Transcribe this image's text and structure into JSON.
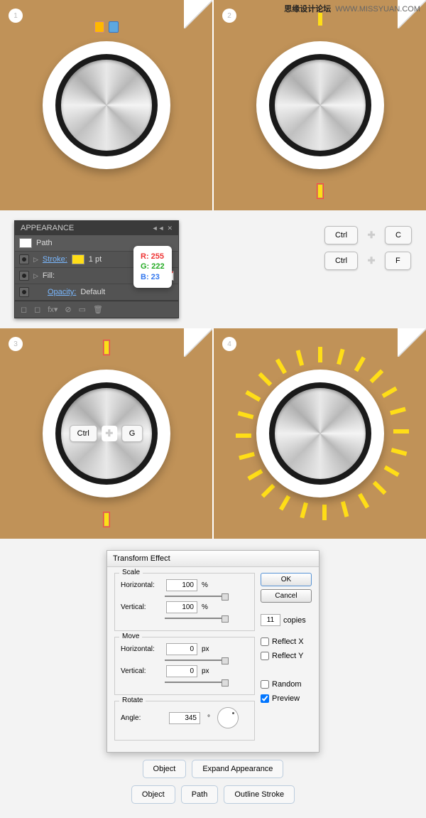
{
  "watermark": {
    "site": "思缘设计论坛",
    "url": "WWW.MISSYUAN.COM"
  },
  "steps": {
    "s1": "1",
    "s2": "2",
    "s3": "3",
    "s4": "4"
  },
  "appearance": {
    "title": "APPEARANCE",
    "path": "Path",
    "stroke_label": "Stroke:",
    "stroke_pt": "1 pt",
    "fill_label": "Fill:",
    "opacity_label": "Opacity:",
    "opacity_val": "Default"
  },
  "rgb": {
    "r": "R: 255",
    "g": "G: 222",
    "b": "B: 23"
  },
  "shortcut": {
    "ctrl": "Ctrl",
    "c": "C",
    "f": "F",
    "g": "G"
  },
  "dialog": {
    "title": "Transform Effect",
    "scale": "Scale",
    "move": "Move",
    "rotate": "Rotate",
    "horizontal": "Horizontal:",
    "vertical": "Vertical:",
    "angle": "Angle:",
    "scale_h": "100",
    "scale_v": "100",
    "move_h": "0",
    "move_v": "0",
    "angle_v": "345",
    "pct": "%",
    "px": "px",
    "deg": "°",
    "ok": "OK",
    "cancel": "Cancel",
    "copies": "11",
    "copies_lbl": "copies",
    "reflect_x": "Reflect X",
    "reflect_y": "Reflect Y",
    "random": "Random",
    "preview": "Preview"
  },
  "menus": {
    "object": "Object",
    "expand": "Expand Appearance",
    "path": "Path",
    "outline": "Outline Stroke"
  }
}
